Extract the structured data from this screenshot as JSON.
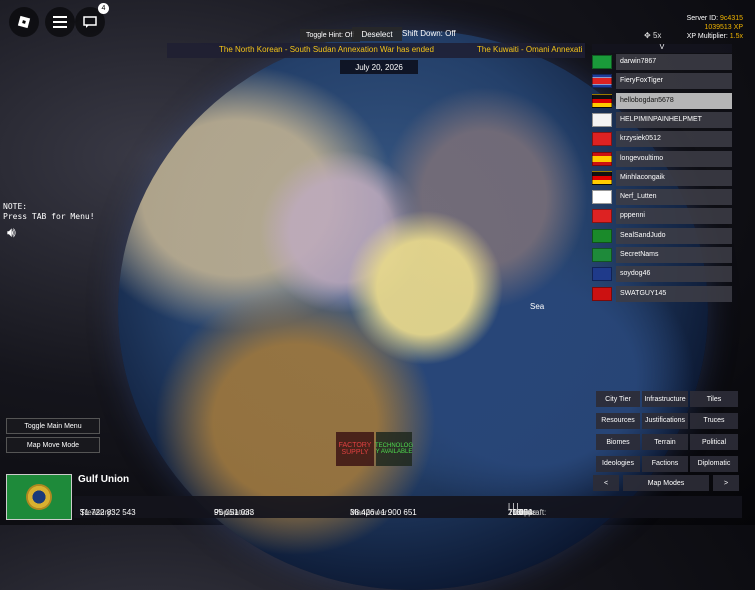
{
  "topleft": {
    "notif_count": "4"
  },
  "toolbar": {
    "toggle_hint": "Toggle Hint: Off",
    "deselect": "Deselect",
    "shift_down": "Shift Down: Off"
  },
  "news": [
    "The North Korean - South Sudan Annexation War has ended",
    "The Kuwaiti - Omani Annexati"
  ],
  "date": "July 20, 2026",
  "server": {
    "id_label": "Server ID:",
    "id_value": "9c4315",
    "xp": "1039513 XP",
    "mult_label": "XP Multiplier:",
    "mult_value": "1.5x"
  },
  "zoom": "5x",
  "player_list": {
    "toggle": "V",
    "players": [
      {
        "name": "darwin7867",
        "flag": "brazil"
      },
      {
        "name": "FieryFoxTiger",
        "flag": "north-korea"
      },
      {
        "name": "hellobogdan5678",
        "flag": "germany",
        "selected": true
      },
      {
        "name": "HELPIMINPAINHELPMET",
        "flag": "uk-ensign"
      },
      {
        "name": "krzysiek0512",
        "flag": "switzerland"
      },
      {
        "name": "longevoultimo",
        "flag": "spain"
      },
      {
        "name": "Minhlacongaik",
        "flag": "germany"
      },
      {
        "name": "Nerf_Lutten",
        "flag": "south-korea"
      },
      {
        "name": "pppenni",
        "flag": "china"
      },
      {
        "name": "SealSandJudo",
        "flag": "jamaica"
      },
      {
        "name": "SecretNams",
        "flag": "green-emblem"
      },
      {
        "name": "soydog46",
        "flag": "uk"
      },
      {
        "name": "SWATGUY145",
        "flag": "soviet"
      }
    ]
  },
  "note": {
    "line1": "NOTE:",
    "line2": "Press TAB for Menu!"
  },
  "left_buttons": {
    "toggle_main_menu": "Toggle Main Menu",
    "map_move_mode": "Map Move Mode"
  },
  "map_labels": {
    "sea": "Sea"
  },
  "factory": {
    "factory": "FACTORY SUPPLY",
    "tech": "TECHNOLOG Y AVAILABLE"
  },
  "map_modes": {
    "buttons": [
      "City Tier",
      "Infrastructure",
      "Tiles",
      "Resources",
      "Justifications",
      "Truces",
      "Biomes",
      "Terrain",
      "Political",
      "Ideologies",
      "Factions",
      "Diplomatic"
    ],
    "prev": "<",
    "label": "Map Modes",
    "next": ">"
  },
  "country": {
    "name": "Gulf Union",
    "treasury_label": "Treasury:",
    "treasury": "$1 722 832 543",
    "population_label": "Population:",
    "population": "95 051 033",
    "manpower_label": "Manpower:",
    "manpower": "38 426 / 1 900 651",
    "troops_label": "Troops:",
    "troops": "20 000",
    "tanks_label": "Tanks:",
    "tanks": "1 554",
    "ships_label": "Ships:",
    "ships": "0",
    "aircraft_label": "Aircraft:",
    "aircraft": "0"
  },
  "colors": {
    "accent_gold": "#f0b400",
    "news_yellow": "#f5c518",
    "factory_red": "#e04040",
    "tech_green": "#4fdc4f"
  }
}
